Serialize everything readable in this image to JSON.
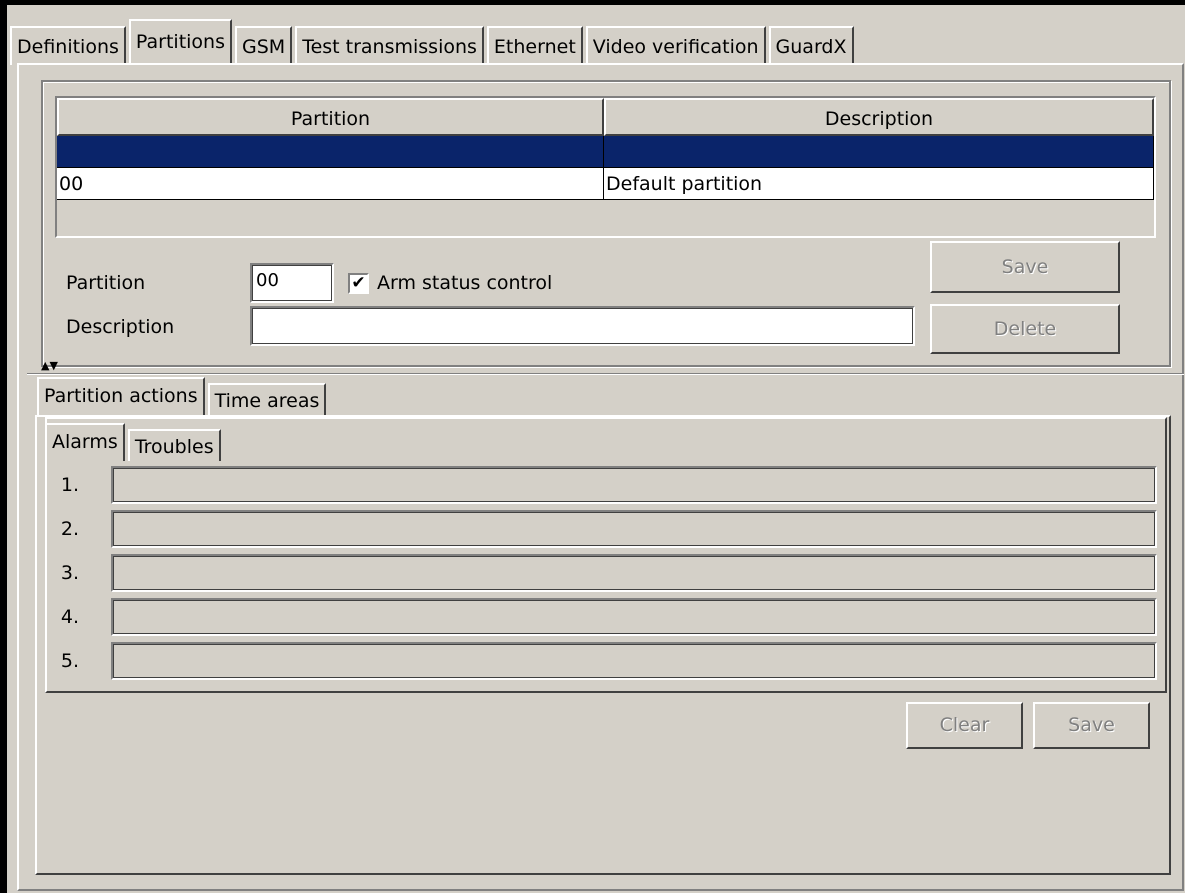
{
  "tabs": [
    "Definitions",
    "Partitions",
    "GSM",
    "Test transmissions",
    "Ethernet",
    "Video verification",
    "GuardX"
  ],
  "active_tab": "Partitions",
  "grid": {
    "columns": [
      "Partition",
      "Description"
    ],
    "rows": [
      {
        "partition": "",
        "description": "",
        "selected": true
      },
      {
        "partition": "00",
        "description": "Default partition",
        "selected": false
      }
    ]
  },
  "form": {
    "partition_label": "Partition",
    "partition_value": "00",
    "arm_status_label": "Arm status control",
    "arm_status_checked": true,
    "description_label": "Description",
    "description_value": "",
    "save_label": "Save",
    "delete_label": "Delete"
  },
  "sub_tabs": [
    "Partition actions",
    "Time areas"
  ],
  "action_tabs": [
    "Alarms",
    "Troubles"
  ],
  "alarms": [
    {
      "num": "1.",
      "value": ""
    },
    {
      "num": "2.",
      "value": ""
    },
    {
      "num": "3.",
      "value": ""
    },
    {
      "num": "4.",
      "value": ""
    },
    {
      "num": "5.",
      "value": ""
    }
  ],
  "bottom_buttons": {
    "clear_label": "Clear",
    "save_label": "Save"
  },
  "colors": {
    "selection": "#0a246a",
    "face": "#d4d0c8"
  }
}
